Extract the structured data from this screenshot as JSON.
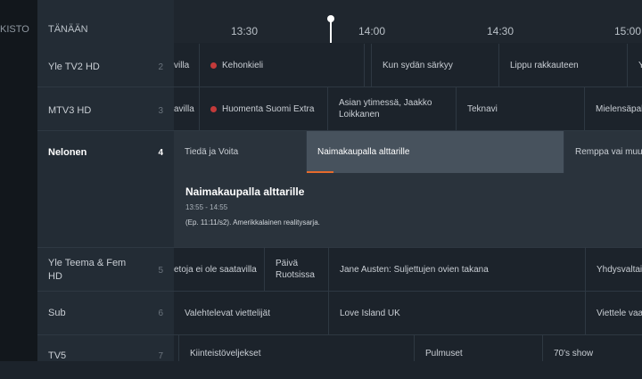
{
  "left_tab": "KISTO",
  "today_label": "TÄNÄÄN",
  "timeline": {
    "ticks": [
      "13:30",
      "14:00",
      "14:30",
      "15:00"
    ]
  },
  "channels": [
    {
      "name": "Yle TV2 HD",
      "num": "2"
    },
    {
      "name": "MTV3 HD",
      "num": "3"
    },
    {
      "name": "Nelonen",
      "num": "4"
    },
    {
      "name": "Yle Teema & Fem HD",
      "num": "5"
    },
    {
      "name": "Sub",
      "num": "6"
    },
    {
      "name": "TV5",
      "num": "7"
    }
  ],
  "rows": {
    "yle_tv2": [
      "villa",
      "Kehonkieli",
      "Kun sydän särkyy",
      "Lippu rakkauteen",
      "Y"
    ],
    "mtv3": [
      "avilla",
      "Huomenta Suomi Extra",
      "Asian ytimessä, Jaakko Loikkanen",
      "Teknavi",
      "Mielensäpah"
    ],
    "nelonen": [
      "Tiedä ja Voita",
      "Naimakaupalla alttarille",
      "Remppa vai muutte"
    ],
    "yle_teema": [
      "etoja ei ole saatavilla",
      "Päivä Ruotsissa",
      "Jane Austen: Suljettujen ovien takana",
      "Yhdysvaltain"
    ],
    "sub": [
      "Valehtelevat viettelijät",
      "Love Island UK",
      "Viettele vaatt"
    ],
    "tv5": [
      "Kiinteistöveljekset",
      "Pulmuset",
      "70's show"
    ]
  },
  "detail": {
    "title": "Naimakaupalla alttarille",
    "time": "13:55 - 14:55",
    "description": "(Ep. 11:11/s2). Amerikkalainen realitysarja."
  },
  "colors": {
    "accent": "#e66a2c",
    "record": "#c33a3a"
  }
}
